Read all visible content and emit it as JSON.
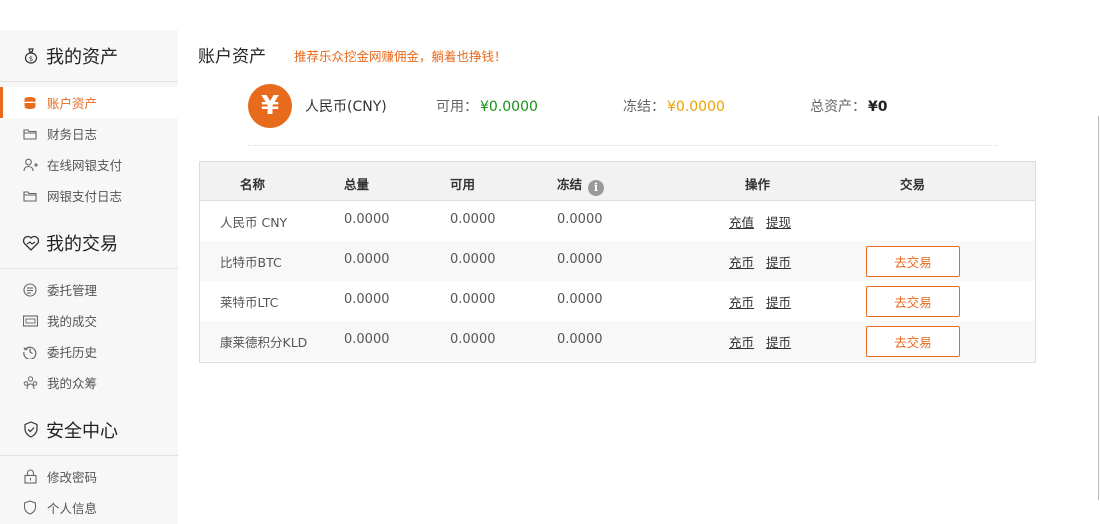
{
  "colors": {
    "accent": "#e86a1c",
    "available": "#1a8f1a",
    "frozen": "#f0a000"
  },
  "sidebar": {
    "sections": [
      {
        "title": "我的资产",
        "icon": "money-bag-icon",
        "items": [
          {
            "label": "账户资产",
            "icon": "coins-stack-icon",
            "active": true
          },
          {
            "label": "财务日志",
            "icon": "folder-icon"
          },
          {
            "label": "在线网银支付",
            "icon": "user-add-icon"
          },
          {
            "label": "网银支付日志",
            "icon": "folder-icon"
          }
        ]
      },
      {
        "title": "我的交易",
        "icon": "handshake-heart-icon",
        "items": [
          {
            "label": "委托管理",
            "icon": "list-circle-icon"
          },
          {
            "label": "我的成交",
            "icon": "card-icon"
          },
          {
            "label": "委托历史",
            "icon": "history-icon"
          },
          {
            "label": "我的众筹",
            "icon": "group-icon"
          }
        ]
      },
      {
        "title": "安全中心",
        "icon": "shield-check-icon",
        "items": [
          {
            "label": "修改密码",
            "icon": "lock-icon"
          },
          {
            "label": "个人信息",
            "icon": "shield-icon"
          }
        ]
      }
    ]
  },
  "main": {
    "title": "账户资产",
    "promo": "推荐乐众挖金网赚佣金，躺着也挣钱！",
    "summary": {
      "currency_symbol": "¥",
      "currency_name": "人民币(CNY)",
      "available_label": "可用：",
      "available_value": "¥0.0000",
      "frozen_label": "冻结：",
      "frozen_value": "¥0.0000",
      "total_label": "总资产：",
      "total_value": "¥0"
    },
    "table": {
      "headers": {
        "name": "名称",
        "total": "总量",
        "available": "可用",
        "frozen": "冻结",
        "frozen_info": "i",
        "actions": "操作",
        "trade": "交易"
      },
      "rows": [
        {
          "name": "人民币 CNY",
          "total": "0.0000",
          "available": "0.0000",
          "frozen": "0.0000",
          "op1": "充值",
          "op2": "提现",
          "trade": ""
        },
        {
          "name": "比特币BTC",
          "total": "0.0000",
          "available": "0.0000",
          "frozen": "0.0000",
          "op1": "充币",
          "op2": "提币",
          "trade": "去交易"
        },
        {
          "name": "莱特币LTC",
          "total": "0.0000",
          "available": "0.0000",
          "frozen": "0.0000",
          "op1": "充币",
          "op2": "提币",
          "trade": "去交易"
        },
        {
          "name": "康莱德积分KLD",
          "total": "0.0000",
          "available": "0.0000",
          "frozen": "0.0000",
          "op1": "充币",
          "op2": "提币",
          "trade": "去交易"
        }
      ]
    }
  }
}
